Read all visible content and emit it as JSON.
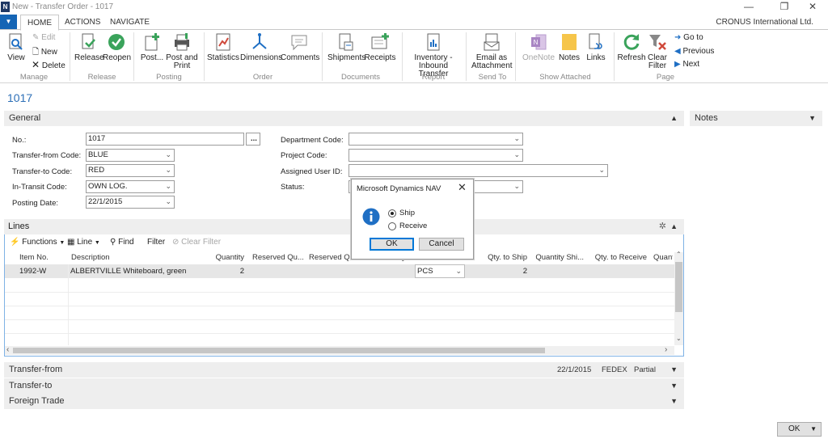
{
  "window": {
    "logo": "N",
    "title": "New - Transfer Order - 1017",
    "controls": {
      "minimize": "—",
      "restore": "❐",
      "close": "✕"
    }
  },
  "ribbon": {
    "tabs": [
      {
        "label": "HOME"
      },
      {
        "label": "ACTIONS"
      },
      {
        "label": "NAVIGATE"
      }
    ],
    "company": "CRONUS International Ltd.",
    "manage": {
      "view": "View",
      "edit": "Edit",
      "new": "New",
      "delete": "Delete",
      "group": "Manage"
    },
    "release": {
      "release": "Release",
      "reopen": "Reopen",
      "group": "Release"
    },
    "posting": {
      "post": "Post...",
      "post_print_1": "Post and",
      "post_print_2": "Print",
      "group": "Posting"
    },
    "order": {
      "statistics": "Statistics",
      "dimensions": "Dimensions",
      "comments": "Comments",
      "group": "Order"
    },
    "documents": {
      "shipments": "Shipments",
      "receipts": "Receipts",
      "group": "Documents"
    },
    "report": {
      "inventory_1": "Inventory -",
      "inventory_2": "Inbound Transfer",
      "group": "Report"
    },
    "sendto": {
      "email_1": "Email as",
      "email_2": "Attachment",
      "group": "Send To"
    },
    "attached": {
      "onenote": "OneNote",
      "notes": "Notes",
      "links": "Links",
      "group": "Show Attached"
    },
    "page": {
      "refresh": "Refresh",
      "clear_1": "Clear",
      "clear_2": "Filter",
      "goto": "Go to",
      "previous": "Previous",
      "next": "Next",
      "group": "Page"
    }
  },
  "page_title": "1017",
  "general": {
    "heading": "General",
    "no": {
      "label": "No.:",
      "value": "1017",
      "assist": "..."
    },
    "transfer_from": {
      "label": "Transfer-from Code:",
      "value": "BLUE"
    },
    "transfer_to": {
      "label": "Transfer-to Code:",
      "value": "RED"
    },
    "in_transit": {
      "label": "In-Transit Code:",
      "value": "OWN LOG."
    },
    "posting_date": {
      "label": "Posting Date:",
      "value": "22/1/2015"
    },
    "department": {
      "label": "Department Code:",
      "value": ""
    },
    "project": {
      "label": "Project Code:",
      "value": ""
    },
    "assigned_user": {
      "label": "Assigned User ID:",
      "value": ""
    },
    "status": {
      "label": "Status:",
      "value": ""
    }
  },
  "notes_heading": "Notes",
  "lines": {
    "heading": "Lines",
    "toolbar": {
      "functions": "Functions",
      "line": "Line",
      "find": "Find",
      "filter": "Filter",
      "clear_filter": "Clear Filter"
    },
    "columns": [
      "Item No.",
      "Description",
      "Quantity",
      "Reserved Qu...",
      "Reserved Qu...",
      "Reserved Quan...",
      "Unit of Meas...",
      "Qty. to Ship",
      "Quantity Shi...",
      "Qty. to Receive",
      "Quant"
    ],
    "rows": [
      {
        "item_no": "1992-W",
        "description": "ALBERTVILLE Whiteboard, green",
        "quantity": "2",
        "uom": "PCS",
        "qty_to_ship": "2"
      }
    ]
  },
  "sections": {
    "transfer_from": {
      "label": "Transfer-from",
      "date": "22/1/2015",
      "carrier": "FEDEX",
      "partial": "Partial"
    },
    "transfer_to": {
      "label": "Transfer-to"
    },
    "foreign_trade": {
      "label": "Foreign Trade"
    }
  },
  "dialog": {
    "title": "Microsoft Dynamics NAV",
    "options": [
      {
        "label": "Ship",
        "selected": true
      },
      {
        "label": "Receive",
        "selected": false
      }
    ],
    "ok": "OK",
    "cancel": "Cancel"
  },
  "footer": {
    "ok": "OK"
  },
  "colors": {
    "accent": "#2c6fb7",
    "nav": "#1565b5",
    "info": "#1f6fc4"
  }
}
